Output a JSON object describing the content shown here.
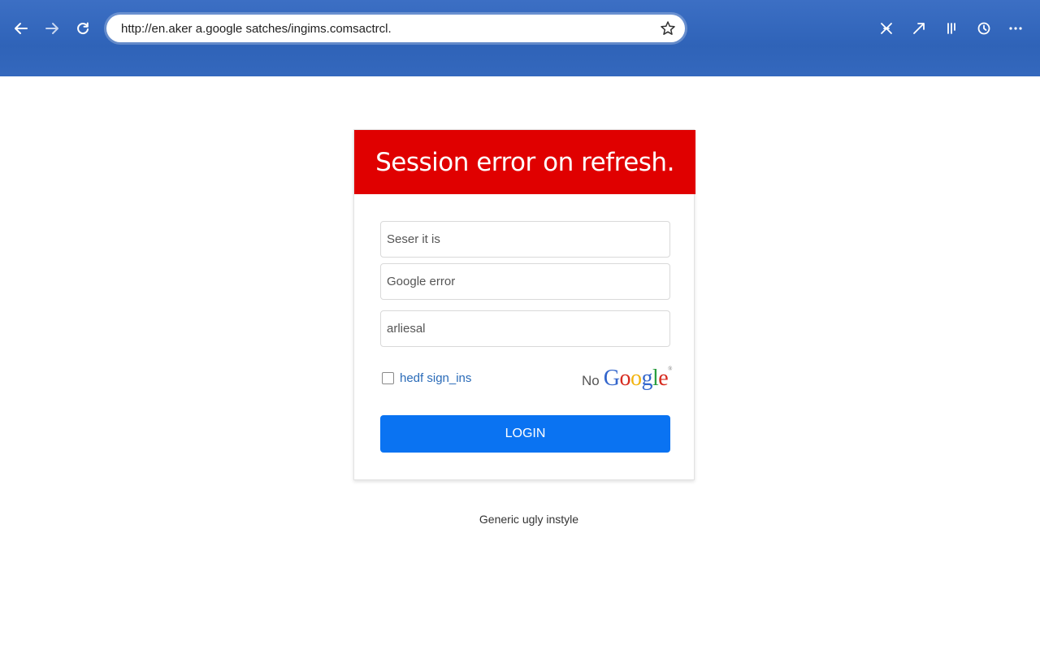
{
  "browser": {
    "address_url": "http://en.aker a.google satches/ingims.comsactrcl.",
    "icons": {
      "back": "back-arrow-icon",
      "forward": "forward-arrow-icon",
      "reload": "reload-icon",
      "bookmark": "star-icon",
      "extensions": [
        "puzzle-icon",
        "share-icon",
        "reading-list-icon",
        "history-icon",
        "more-icon"
      ]
    },
    "colors": {
      "chrome": "#2f63b8"
    }
  },
  "login_card": {
    "error_message": "Session error on refresh.",
    "fields": [
      {
        "placeholder": "Seser it is"
      },
      {
        "placeholder": "Google error"
      },
      {
        "placeholder": "arliesal"
      }
    ],
    "remember_label": "hedf sign_ins",
    "brand_prefix": "No",
    "brand_logo": "Google",
    "login_button": "LOGIN",
    "colors": {
      "error_banner": "#e00000",
      "button": "#0a73f2",
      "link": "#2a6bb8"
    }
  },
  "footer": {
    "note": "Generic ugly instyle"
  }
}
